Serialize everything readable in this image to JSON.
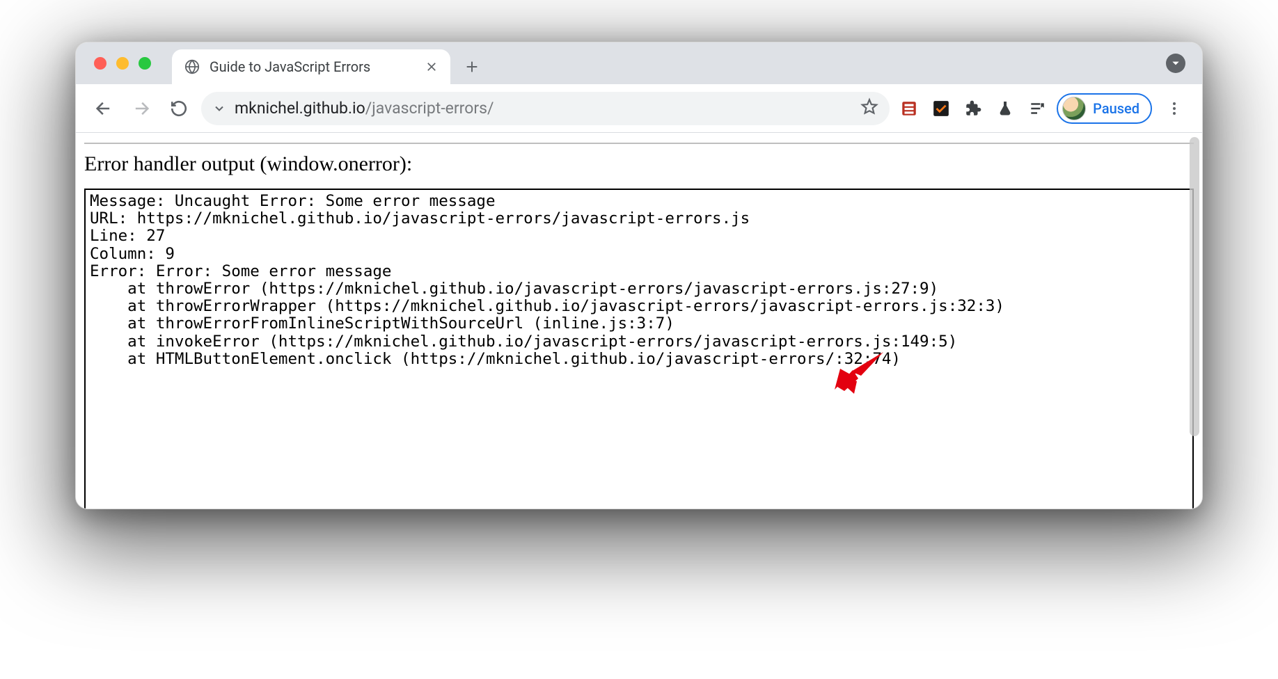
{
  "tab": {
    "title": "Guide to JavaScript Errors"
  },
  "address": {
    "host": "mknichel.github.io",
    "path": "/javascript-errors/"
  },
  "profile": {
    "status": "Paused"
  },
  "page": {
    "heading": "Error handler output (window.onerror):",
    "output": "Message: Uncaught Error: Some error message\nURL: https://mknichel.github.io/javascript-errors/javascript-errors.js\nLine: 27\nColumn: 9\nError: Error: Some error message\n    at throwError (https://mknichel.github.io/javascript-errors/javascript-errors.js:27:9)\n    at throwErrorWrapper (https://mknichel.github.io/javascript-errors/javascript-errors.js:32:3)\n    at throwErrorFromInlineScriptWithSourceUrl (inline.js:3:7)\n    at invokeError (https://mknichel.github.io/javascript-errors/javascript-errors.js:149:5)\n    at HTMLButtonElement.onclick (https://mknichel.github.io/javascript-errors/:32:74)"
  }
}
